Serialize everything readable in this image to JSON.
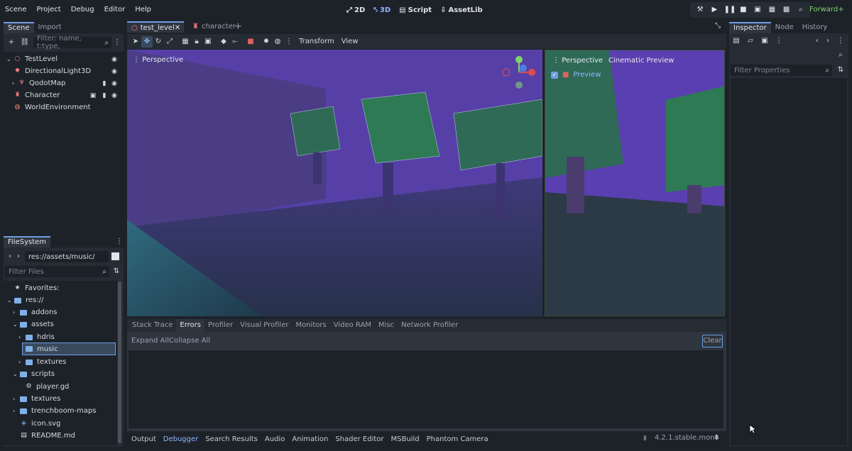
{
  "menu": [
    "Scene",
    "Project",
    "Debug",
    "Editor",
    "Help"
  ],
  "workspaces": [
    {
      "label": "2D",
      "icon": "2d-icon",
      "active": false
    },
    {
      "label": "3D",
      "icon": "3d-icon",
      "active": true
    },
    {
      "label": "Script",
      "icon": "script-icon",
      "active": false
    },
    {
      "label": "AssetLib",
      "icon": "assetlib-icon",
      "active": false
    }
  ],
  "renderer": "Forward+",
  "scene_dock": {
    "tabs": [
      "Scene",
      "Import"
    ],
    "filter_placeholder": "Filter: name, t:type,",
    "nodes": [
      {
        "name": "TestLevel",
        "icon": "node3d-icon",
        "color": "#fc7f7f"
      },
      {
        "name": "DirectionalLight3D",
        "icon": "directional-light-icon",
        "color": "#fc7f7f"
      },
      {
        "name": "QodotMap",
        "icon": "qodot-map-icon",
        "color": "#fc7f7f"
      },
      {
        "name": "Character",
        "icon": "character-icon",
        "color": "#fc7f7f"
      },
      {
        "name": "WorldEnvironment",
        "icon": "world-environment-icon",
        "color": "#ee8270"
      }
    ]
  },
  "filesystem": {
    "tab": "FileSystem",
    "path": "res://assets/music/",
    "filter_placeholder": "Filter Files",
    "items": [
      {
        "label": "Favorites:",
        "icon": "star-icon"
      },
      {
        "label": "res://",
        "icon": "folder-icon"
      },
      {
        "label": "addons",
        "icon": "folder-icon"
      },
      {
        "label": "assets",
        "icon": "folder-icon"
      },
      {
        "label": "hdris",
        "icon": "folder-icon"
      },
      {
        "label": "music",
        "icon": "folder-icon",
        "selected": true
      },
      {
        "label": "textures",
        "icon": "folder-icon"
      },
      {
        "label": "scripts",
        "icon": "folder-icon"
      },
      {
        "label": "player.gd",
        "icon": "gear-icon"
      },
      {
        "label": "textures",
        "icon": "folder-icon"
      },
      {
        "label": "trenchboom-maps",
        "icon": "folder-icon"
      },
      {
        "label": "icon.svg",
        "icon": "svg-file-icon"
      },
      {
        "label": "README.md",
        "icon": "text-file-icon"
      }
    ]
  },
  "editor_tabs": [
    {
      "label": "test_level",
      "active": true
    },
    {
      "label": "character",
      "active": false
    }
  ],
  "viewport_toolbar": {
    "transform": "Transform",
    "view": "View"
  },
  "viewport": {
    "label": "Perspective"
  },
  "preview": {
    "label": "Perspective",
    "cinematic": "Cinematic Preview",
    "preview": "Preview"
  },
  "debugger": {
    "tabs": [
      "Stack Trace",
      "Errors",
      "Profiler",
      "Visual Profiler",
      "Monitors",
      "Video RAM",
      "Misc",
      "Network Profiler"
    ],
    "active_tab": "Errors",
    "expand_all": "Expand All",
    "collapse_all": "Collapse All",
    "clear": "Clear"
  },
  "bottom_tabs": [
    "Output",
    "Debugger",
    "Search Results",
    "Audio",
    "Animation",
    "Shader Editor",
    "MSBuild",
    "Phantom Camera"
  ],
  "version": "4.2.1.stable.mono",
  "inspector": {
    "tabs": [
      "Inspector",
      "Node",
      "History"
    ],
    "filter_placeholder": "Filter Properties"
  },
  "colors": {
    "accent": "#6f9de3",
    "bg": "#1d2229",
    "panel": "#262c34",
    "renderer": "#7fd36b"
  }
}
